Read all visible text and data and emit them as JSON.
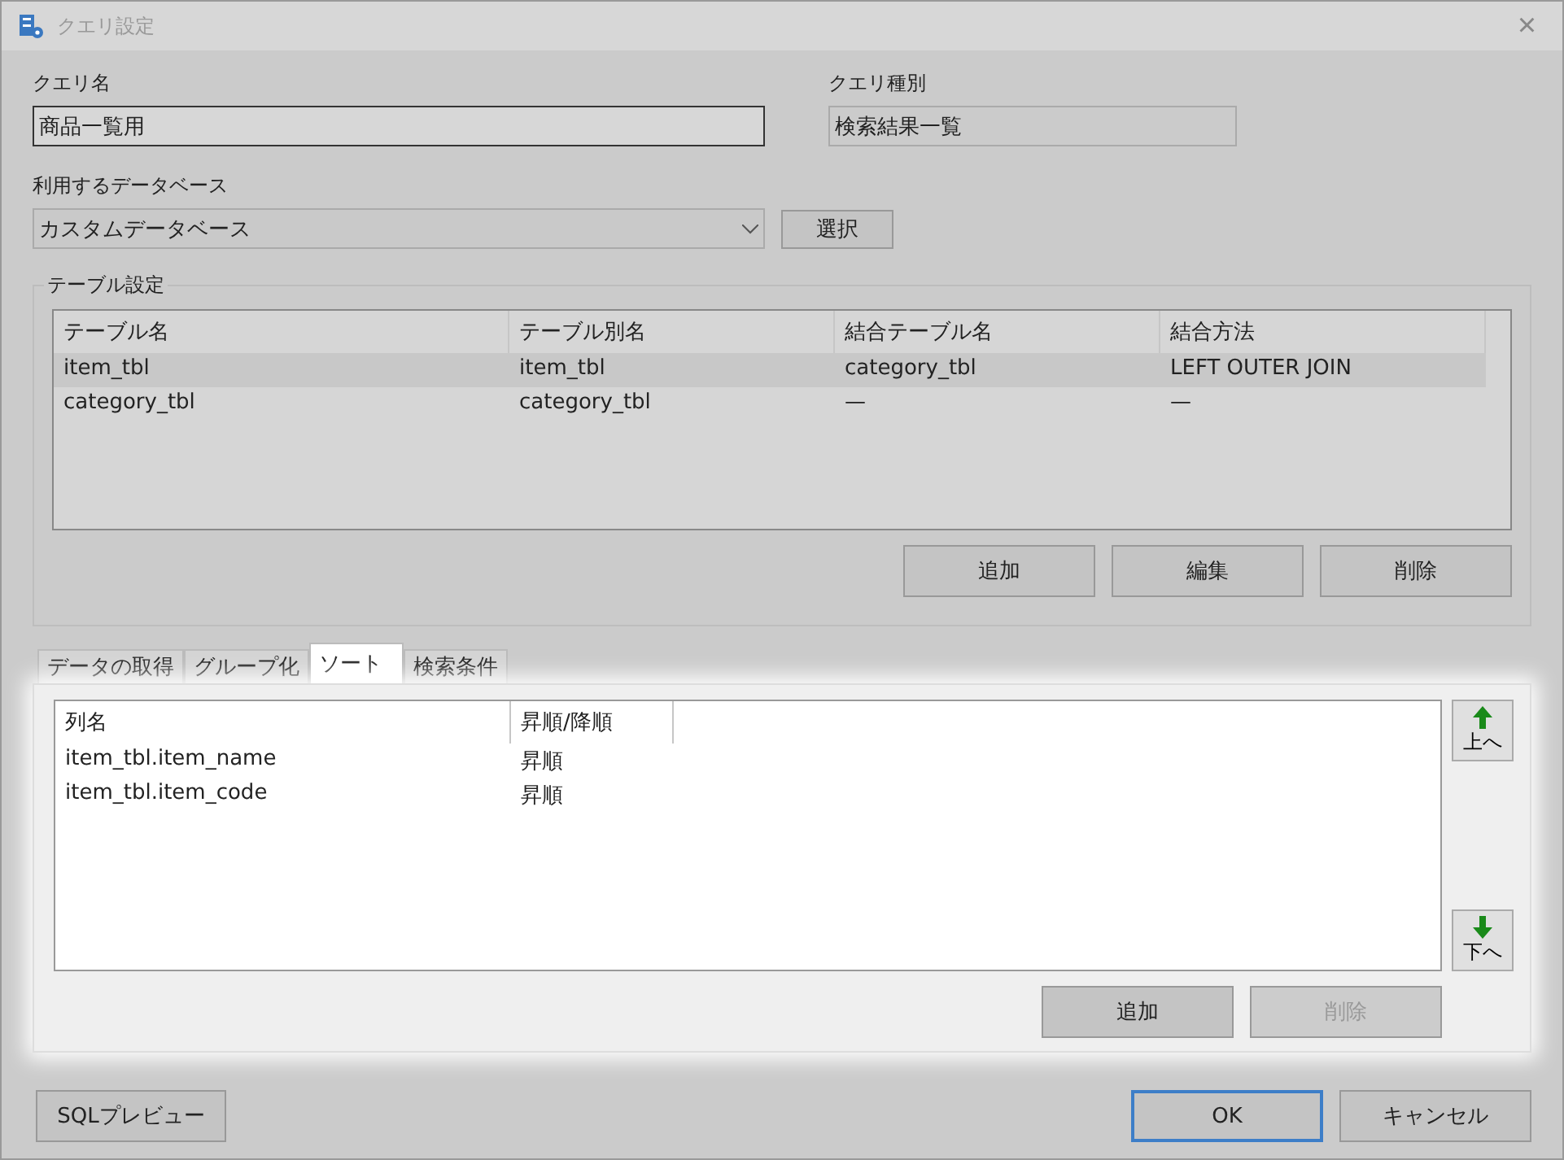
{
  "window": {
    "title": "クエリ設定",
    "close": "×"
  },
  "query_name": {
    "label": "クエリ名",
    "value": "商品一覧用"
  },
  "query_type": {
    "label": "クエリ種別",
    "value": "検索結果一覧"
  },
  "database": {
    "label": "利用するデータベース",
    "value": "カスタムデータベース",
    "button": "選択"
  },
  "table_settings": {
    "title": "テーブル設定",
    "columns": [
      "テーブル名",
      "テーブル別名",
      "結合テーブル名",
      "結合方法"
    ],
    "rows": [
      {
        "cells": [
          "item_tbl",
          "item_tbl",
          "category_tbl",
          "LEFT OUTER JOIN"
        ],
        "selected": true
      },
      {
        "cells": [
          "category_tbl",
          "category_tbl",
          "—",
          "—"
        ],
        "selected": false
      }
    ],
    "buttons": [
      "追加",
      "編集",
      "削除"
    ]
  },
  "tabs": [
    {
      "label": "データの取得",
      "selected": false
    },
    {
      "label": "グループ化",
      "selected": false
    },
    {
      "label": "ソート",
      "selected": true
    },
    {
      "label": "検索条件",
      "selected": false
    }
  ],
  "sort": {
    "columns": [
      "列名",
      "昇順/降順"
    ],
    "rows": [
      {
        "cells": [
          "item_tbl.item_name",
          "昇順"
        ]
      },
      {
        "cells": [
          "item_tbl.item_code",
          "昇順"
        ]
      }
    ],
    "up_button": "上へ",
    "down_button": "下へ",
    "buttons": [
      {
        "label": "追加",
        "disabled": false
      },
      {
        "label": "削除",
        "disabled": true
      }
    ]
  },
  "footer": [
    {
      "label": "SQLプレビュー",
      "default": false
    },
    {
      "label": "OK",
      "default": true
    },
    {
      "label": "キャンセル",
      "default": false
    }
  ]
}
